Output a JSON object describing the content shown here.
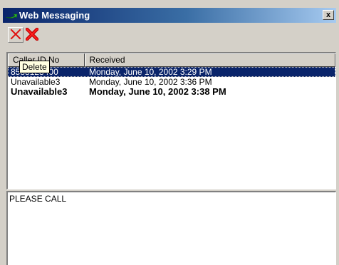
{
  "window": {
    "title": "Web Messaging",
    "close_label": "x",
    "icon": "green-arrow-icon"
  },
  "toolbar": {
    "buttons": [
      {
        "name": "delete",
        "icon": "red-x-outline-icon"
      },
      {
        "name": "delete-all",
        "icon": "red-x-bold-icon"
      }
    ]
  },
  "tooltip": {
    "text": "Delete"
  },
  "list": {
    "columns": [
      {
        "label": "Caller ID No"
      },
      {
        "label": "Received"
      }
    ],
    "rows": [
      {
        "caller": "8588123400",
        "received": "Monday, June 10, 2002 3:29 PM",
        "selected": true,
        "unread": false
      },
      {
        "caller": "Unavailable3",
        "received": "Monday, June 10, 2002 3:36 PM",
        "selected": false,
        "unread": false
      },
      {
        "caller": "Unavailable3",
        "received": "Monday, June 10, 2002 3:38 PM",
        "selected": false,
        "unread": true
      }
    ]
  },
  "message": {
    "text": "PLEASE CALL"
  },
  "colors": {
    "title_gradient_start": "#0a246a",
    "title_gradient_end": "#a6caf0",
    "selection": "#0a246a",
    "icon_red": "#e01010",
    "icon_green": "#2db52d",
    "face": "#d4d0c8"
  }
}
